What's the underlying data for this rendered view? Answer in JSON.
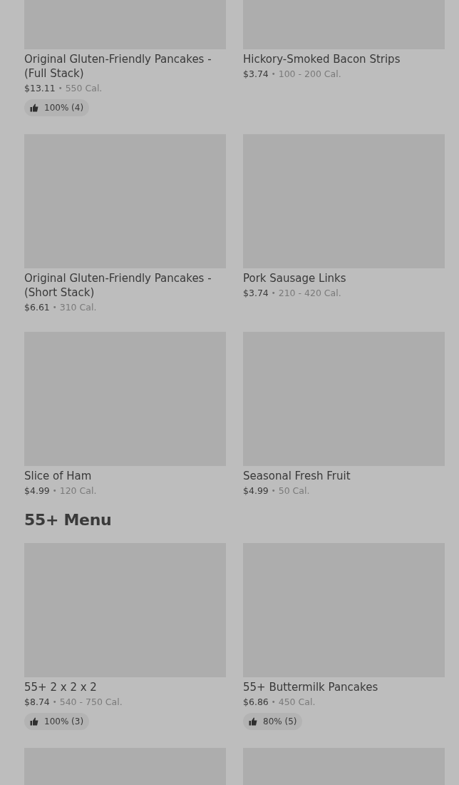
{
  "sections": [
    {
      "items": [
        {
          "title": "Original Gluten-Friendly Pancakes - (Full Stack)",
          "price": "$13.11",
          "separator": "•",
          "calories": "550 Cal.",
          "rating": "100% (4)"
        },
        {
          "title": "Hickory-Smoked Bacon Strips",
          "price": "$3.74",
          "separator": "•",
          "calories": "100 - 200 Cal."
        },
        {
          "title": "Original Gluten-Friendly Pancakes - (Short Stack)",
          "price": "$6.61",
          "separator": "•",
          "calories": "310 Cal."
        },
        {
          "title": "Pork Sausage Links",
          "price": "$3.74",
          "separator": "•",
          "calories": "210 - 420 Cal."
        },
        {
          "title": "Slice of Ham",
          "price": "$4.99",
          "separator": "•",
          "calories": "120 Cal."
        },
        {
          "title": "Seasonal Fresh Fruit",
          "price": "$4.99",
          "separator": "•",
          "calories": "50 Cal."
        }
      ]
    },
    {
      "title": "55+ Menu",
      "items": [
        {
          "title": "55+ 2 x 2 x 2",
          "price": "$8.74",
          "separator": "•",
          "calories": "540 - 750 Cal.",
          "rating": "100% (3)"
        },
        {
          "title": "55+ Buttermilk Pancakes",
          "price": "$6.86",
          "separator": "•",
          "calories": "450 Cal.",
          "rating": "80% (5)"
        },
        {
          "kind": "picture"
        },
        {
          "kind": "picture"
        }
      ]
    }
  ]
}
